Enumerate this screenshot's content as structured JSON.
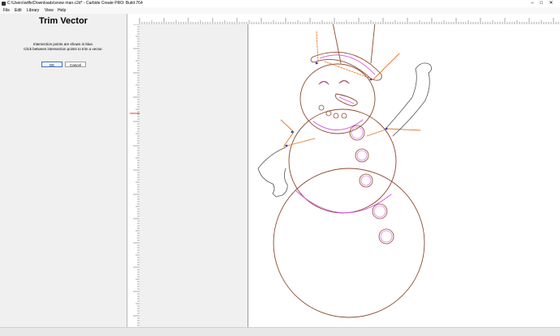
{
  "window": {
    "title": "C:\\Users\\wilfe\\Downloads\\snow man.c2d* - Carbide Create PRO: Build 764",
    "minimize_glyph": "–",
    "maximize_glyph": "□",
    "close_glyph": "✕"
  },
  "menu": {
    "items": [
      "File",
      "Edit",
      "Library",
      "View",
      "Help"
    ]
  },
  "panel": {
    "title": "Trim Vector",
    "info_line1": "Intersection points are shown in blue.",
    "info_line2": "Click between intersection points to trim a vector.",
    "ok_label": "OK",
    "cancel_label": "Cancel"
  },
  "colors": {
    "outline": "#8b4a2e",
    "highlight": "#d455e0",
    "trim_line": "#e8762a",
    "intersection": "#3040c0",
    "ruler_marker": "#e04040"
  }
}
